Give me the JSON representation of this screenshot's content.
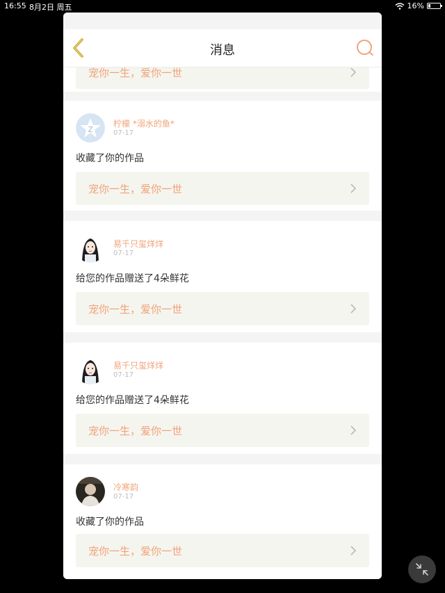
{
  "status_bar": {
    "time": "16:55",
    "date": "8月2日 周五",
    "battery": "16%",
    "battery_level": 0.16
  },
  "nav": {
    "title": "消息",
    "back_icon": "chevron-left-icon",
    "search_icon": "search-icon"
  },
  "colors": {
    "accent": "#f0a37a",
    "back": "#c9a227"
  },
  "partial_item": {
    "work_title": "宠你一生，爱你一世"
  },
  "messages": [
    {
      "user": "柠檬 *溺水的鱼*",
      "date": "07-17",
      "action": "收藏了你的作品",
      "work_title": "宠你一生，爱你一世",
      "avatar": "qq-default-avatar-icon"
    },
    {
      "user": "易千只玺烊烊",
      "date": "07-17",
      "action": "给您的作品赠送了4朵鲜花",
      "work_title": "宠你一生，爱你一世",
      "avatar": "illustrated-girl-avatar"
    },
    {
      "user": "易千只玺烊烊",
      "date": "07-17",
      "action": "给您的作品赠送了4朵鲜花",
      "work_title": "宠你一生，爱你一世",
      "avatar": "illustrated-girl-avatar"
    },
    {
      "user": "冷寒韵",
      "date": "07-17",
      "action": "收藏了你的作品",
      "work_title": "宠你一生，爱你一世",
      "avatar": "photo-avatar"
    }
  ]
}
